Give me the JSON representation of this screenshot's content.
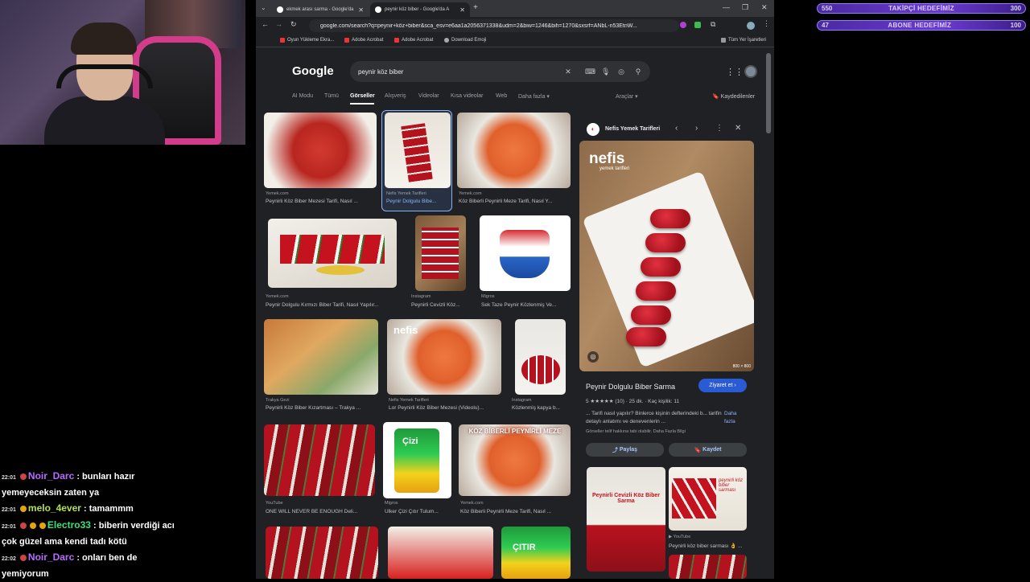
{
  "overlay": {
    "goals": [
      {
        "left": "550",
        "label": "TAKİPÇİ HEDEFİMİZ",
        "right": "300"
      },
      {
        "left": "47",
        "label": "ABONE HEDEFİMİZ",
        "right": "100"
      }
    ],
    "chat": [
      {
        "time": "22:01",
        "name": "Noir_Darc",
        "text": ": bunları hazır",
        "cont": "yemeyeceksin zaten ya"
      },
      {
        "time": "22:01",
        "name": "melo_4ever",
        "text": ": tamammm",
        "cont": ""
      },
      {
        "time": "22:01",
        "name": "Electro33",
        "text": ": biberin verdiği acı",
        "cont": "çok güzel ama kendi tadı kötü"
      },
      {
        "time": "22:02",
        "name": "Noir_Darc",
        "text": ": onları ben de",
        "cont": "yemiyorum"
      }
    ]
  },
  "browser": {
    "tabs": [
      {
        "title": "ekmek arası sarma - Google'da",
        "active": false
      },
      {
        "title": "peynir köz biber - Google'da A",
        "active": true
      }
    ],
    "new_tab": "+",
    "url": "google.com/search?q=peynir+köz+biber&sca_esv=e6aa1a2056371338&udm=2&biw=1246&bih=1270&sxsrf=ANbL-n53EtnW...",
    "bookmarks": [
      "Oyun Yükleme Ekra...",
      "Adobe Acrobat",
      "Adobe Acrobat",
      "Download Emoji"
    ],
    "all_bookmarks": "Tüm Yer İşaretleri"
  },
  "google": {
    "logo": "Google",
    "query": "peynir köz biber",
    "filters": [
      "AI Modu",
      "Tümü",
      "Görseller",
      "Alışveriş",
      "Videolar",
      "Kısa videolar",
      "Web",
      "Daha fazla ▾"
    ],
    "tools": "Araçlar ▾",
    "saved": "Kaydedilenler",
    "results": [
      {
        "source": "Yemek.com",
        "title": "Peynirli Köz Biber Mezesi Tarifi, Nasıl ..."
      },
      {
        "source": "Nefis Yemek Tarifleri",
        "title": "Peynir Dolgulu Bibe..."
      },
      {
        "source": "Yemek.com",
        "title": "Köz Biberli Peynirli Meze Tarifi, Nasıl Y..."
      },
      {
        "source": "Yemek.com",
        "title": "Peynir Dolgulu Kırmızı Biber Tarifi, Nasıl Yapılır..."
      },
      {
        "source": "Instagram",
        "title": "Peynirli Cevizli Köz..."
      },
      {
        "source": "Migros",
        "title": "Sek Taze Peynir Közlenmiş Ve..."
      },
      {
        "source": "Trakya Gezi",
        "title": "Peynirli Köz Biber Kızartması – Trakya ..."
      },
      {
        "source": "Nefis Yemek Tarifleri",
        "title": "Lor Peynirli Köz Biber Mezesi (Videolu)..."
      },
      {
        "source": "Instagram",
        "title": "Közlenmiş kapya b..."
      },
      {
        "source": "YouTube",
        "title": "ONE WILL NEVER BE ENOUGH Deli..."
      },
      {
        "source": "Migros",
        "title": "Ülker Çizi Çıtır Tulum..."
      },
      {
        "source": "Yemek.com",
        "title": "Köz Biberli Peynirli Meze Tarifi, Nasıl ..."
      }
    ],
    "overlay_texts": {
      "nefis": "nefis",
      "nefis_sub": "yemek tarifleri",
      "koz_meze": "KÖZ BİBERLİ PEYNİRLİ MEZE",
      "cizi": "Çizi",
      "citir": "ÇITIR"
    },
    "panel": {
      "site": "Nefis Yemek Tarifleri",
      "img_size": "800 × 800",
      "title": "Peynir Dolgulu Biber Sarma",
      "visit": "Ziyaret et",
      "rating": "5 ★★★★★ (10) · 25 dk. · Kaç kişilik: 11",
      "desc": "... Tarifi nasıl yapılır? Binlerce kişinin defterindeki b... tarifin detaylı anlatımı ve denevenlerin ...",
      "more": "Daha fazla",
      "copyright": "Görseller telif hakkına tabi olabilir. Daha Fazla Bilgi",
      "share": "Paylaş",
      "save": "Kaydet",
      "related_title1": "Peynirli Cevizli Köz Biber Sarma",
      "related_source": "YouTube",
      "related_caption": "Peynirli köz biber sarması 👌 ...",
      "related_overlay": "peynirli köz biber sarması"
    }
  }
}
